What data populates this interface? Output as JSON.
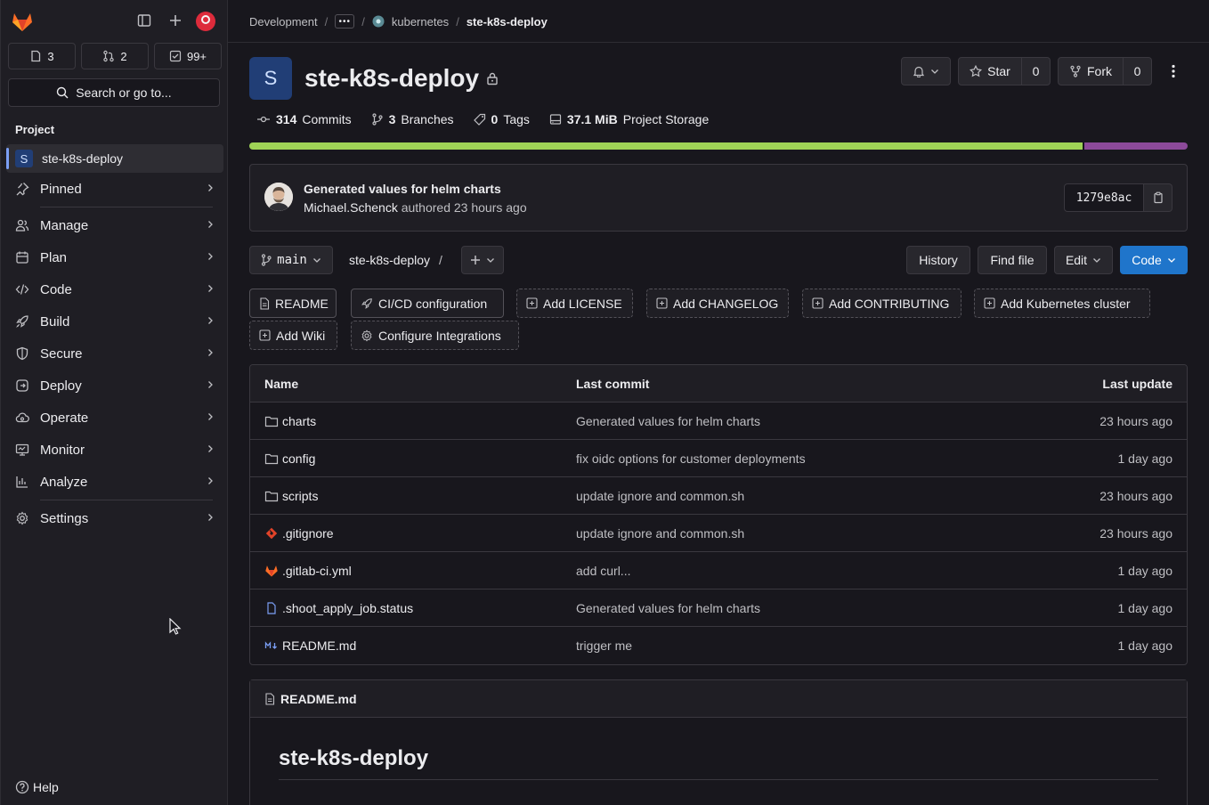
{
  "sidebar": {
    "counts": {
      "issues": "3",
      "merge_requests": "2",
      "todos": "99+"
    },
    "search_label": "Search or go to...",
    "section_label": "Project",
    "project_avatar": "S",
    "project_name": "ste-k8s-deploy",
    "items": [
      {
        "label": "Pinned",
        "icon": "pin-icon"
      },
      {
        "label": "Manage",
        "icon": "users-icon"
      },
      {
        "label": "Plan",
        "icon": "calendar-icon"
      },
      {
        "label": "Code",
        "icon": "code-icon"
      },
      {
        "label": "Build",
        "icon": "rocket-icon"
      },
      {
        "label": "Secure",
        "icon": "shield-icon"
      },
      {
        "label": "Deploy",
        "icon": "deploy-icon"
      },
      {
        "label": "Operate",
        "icon": "cloud-icon"
      },
      {
        "label": "Monitor",
        "icon": "monitor-icon"
      },
      {
        "label": "Analyze",
        "icon": "chart-icon"
      },
      {
        "label": "Settings",
        "icon": "gear-icon"
      }
    ],
    "help_label": "Help"
  },
  "breadcrumb": {
    "group": "Development",
    "more": "•••",
    "subgroup": "kubernetes",
    "current": "ste-k8s-deploy"
  },
  "project": {
    "avatar": "S",
    "title": "ste-k8s-deploy",
    "star_label": "Star",
    "star_count": "0",
    "fork_label": "Fork",
    "fork_count": "0"
  },
  "stats": {
    "commits_num": "314",
    "commits_label": "Commits",
    "branches_num": "3",
    "branches_label": "Branches",
    "tags_num": "0",
    "tags_label": "Tags",
    "storage_num": "37.1 MiB",
    "storage_label": "Project Storage"
  },
  "language_bar": [
    {
      "color": "#9fd356",
      "fraction": 0.89
    },
    {
      "color": "#8c4a9a",
      "fraction": 0.11
    }
  ],
  "last_commit": {
    "title": "Generated values for helm charts",
    "author": "Michael.Schenck",
    "authored_text": "authored 23 hours ago",
    "sha": "1279e8ac"
  },
  "repo_bar": {
    "branch": "main",
    "path": "ste-k8s-deploy",
    "path_sep": "/",
    "history": "History",
    "find_file": "Find file",
    "edit": "Edit",
    "code": "Code"
  },
  "chips": [
    {
      "label": "README",
      "icon": "doc-icon"
    },
    {
      "label": "CI/CD configuration",
      "icon": "rocket-icon"
    },
    {
      "label": "Add LICENSE",
      "icon": "plus-square-icon"
    },
    {
      "label": "Add CHANGELOG",
      "icon": "plus-square-icon"
    },
    {
      "label": "Add CONTRIBUTING",
      "icon": "plus-square-icon"
    },
    {
      "label": "Add Kubernetes cluster",
      "icon": "plus-square-icon"
    },
    {
      "label": "Add Wiki",
      "icon": "plus-square-icon"
    },
    {
      "label": "Configure Integrations",
      "icon": "gear-icon"
    }
  ],
  "table": {
    "headers": {
      "name": "Name",
      "commit": "Last commit",
      "date": "Last update"
    },
    "rows": [
      {
        "name": "charts",
        "icon": "folder-icon",
        "commit": "Generated values for helm charts",
        "date": "23 hours ago"
      },
      {
        "name": "config",
        "icon": "folder-icon",
        "commit": "fix oidc options for customer deployments",
        "date": "1 day ago"
      },
      {
        "name": "scripts",
        "icon": "folder-icon",
        "commit": "update ignore and common.sh",
        "date": "23 hours ago"
      },
      {
        "name": ".gitignore",
        "icon": "git-icon",
        "commit": "update ignore and common.sh",
        "date": "23 hours ago"
      },
      {
        "name": ".gitlab-ci.yml",
        "icon": "gitlab-icon",
        "commit": "add curl...",
        "date": "1 day ago"
      },
      {
        "name": ".shoot_apply_job.status",
        "icon": "file-icon",
        "commit": "Generated values for helm charts",
        "date": "1 day ago"
      },
      {
        "name": "README.md",
        "icon": "markdown-icon",
        "commit": "trigger me",
        "date": "1 day ago"
      }
    ]
  },
  "readme": {
    "filename": "README.md",
    "heading": "ste-k8s-deploy"
  }
}
